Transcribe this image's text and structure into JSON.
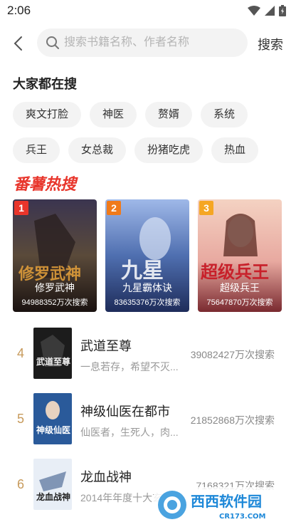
{
  "status": {
    "time": "2:06"
  },
  "search": {
    "placeholder": "搜索书籍名称、作者名称",
    "value": "",
    "button_label": "搜索"
  },
  "hot_searches": {
    "title": "大家都在搜",
    "tags": [
      "爽文打脸",
      "神医",
      "赘婿",
      "系统",
      "兵王",
      "女总裁",
      "扮猪吃虎",
      "热血"
    ]
  },
  "ranking": {
    "logo_text": "番薯热搜",
    "top3": [
      {
        "rank": "1",
        "name": "修罗武神",
        "searches": "94988352万次搜索",
        "cover_text": "修罗武神",
        "badge_color": "#e8352b"
      },
      {
        "rank": "2",
        "name": "九星霸体诀",
        "searches": "83635376万次搜索",
        "cover_text": "九星",
        "badge_color": "#f07a1a"
      },
      {
        "rank": "3",
        "name": "超级兵王",
        "searches": "75647870万次搜索",
        "cover_text": "超级兵王",
        "badge_color": "#f5a623"
      }
    ],
    "list": [
      {
        "rank": "4",
        "title": "武道至尊",
        "desc": "一息若存，希望不灭...",
        "count": "39082427万次搜索",
        "cover_text": "武道至尊"
      },
      {
        "rank": "5",
        "title": "神级仙医在都市",
        "desc": "仙医者，生死人，肉...",
        "count": "21852868万次搜索",
        "cover_text": "神级仙医"
      },
      {
        "rank": "6",
        "title": "龙血战神",
        "desc": "2014年年度十大玄幻",
        "count": "7168321万次搜索",
        "cover_text": "龙血战神"
      }
    ]
  },
  "watermark": {
    "site": "西西软件园",
    "domain": "CR173.COM"
  },
  "colors": {
    "accent": "#e8352b",
    "rank_text": "#c79a5b",
    "tag_bg": "#f3f3f3"
  }
}
